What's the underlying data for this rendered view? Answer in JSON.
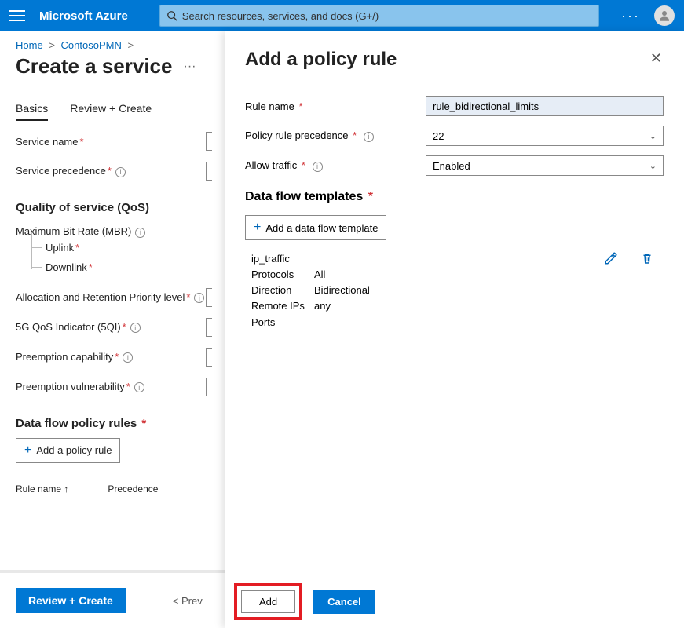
{
  "topbar": {
    "brand": "Microsoft Azure",
    "search_placeholder": "Search resources, services, and docs (G+/)",
    "ellipsis": "···"
  },
  "crumbs": {
    "home": "Home",
    "pmn": "ContosoPMN"
  },
  "page": {
    "title": "Create a service",
    "ellipsis": "···",
    "tabs": {
      "basics": "Basics",
      "review": "Review + Create"
    },
    "labels": {
      "service_name": "Service name",
      "service_precedence": "Service precedence",
      "qos_h": "Quality of service (QoS)",
      "mbr": "Maximum Bit Rate (MBR)",
      "uplink": "Uplink",
      "downlink": "Downlink",
      "arp": "Allocation and Retention Priority level",
      "fiveqi": "5G QoS Indicator (5QI)",
      "pre_cap": "Preemption capability",
      "pre_vul": "Preemption vulnerability",
      "rules_h": "Data flow policy rules",
      "add_rule": "Add a policy rule",
      "col_name": "Rule name ↑",
      "col_prec": "Precedence"
    },
    "footer": {
      "review": "Review + Create",
      "prev": "< Prev"
    }
  },
  "blade": {
    "title": "Add a policy rule",
    "labels": {
      "rule_name": "Rule name",
      "precedence": "Policy rule precedence",
      "allow": "Allow traffic",
      "templates_h": "Data flow templates",
      "add_template": "Add a data flow template"
    },
    "values": {
      "rule_name": "rule_bidirectional_limits",
      "precedence": "22",
      "allow": "Enabled"
    },
    "flow": {
      "name": "ip_traffic",
      "k_proto": "Protocols",
      "v_proto": "All",
      "k_dir": "Direction",
      "v_dir": "Bidirectional",
      "k_ips": "Remote IPs",
      "v_ips": "any",
      "k_ports": "Ports",
      "v_ports": ""
    },
    "footer": {
      "add": "Add",
      "cancel": "Cancel"
    }
  }
}
